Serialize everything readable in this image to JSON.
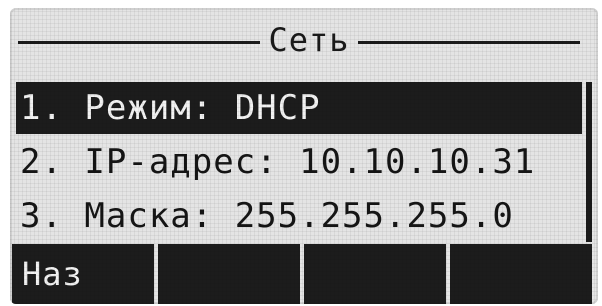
{
  "screen": {
    "title": "Сеть"
  },
  "menu": {
    "items": [
      {
        "label": "1. Режим: DHCP",
        "selected": true
      },
      {
        "label": "2. IP-адрес: 10.10.10.31",
        "selected": false
      },
      {
        "label": "3. Маска: 255.255.255.0",
        "selected": false
      }
    ]
  },
  "softkeys": [
    {
      "label": "Наз"
    },
    {
      "label": ""
    },
    {
      "label": ""
    },
    {
      "label": ""
    }
  ]
}
